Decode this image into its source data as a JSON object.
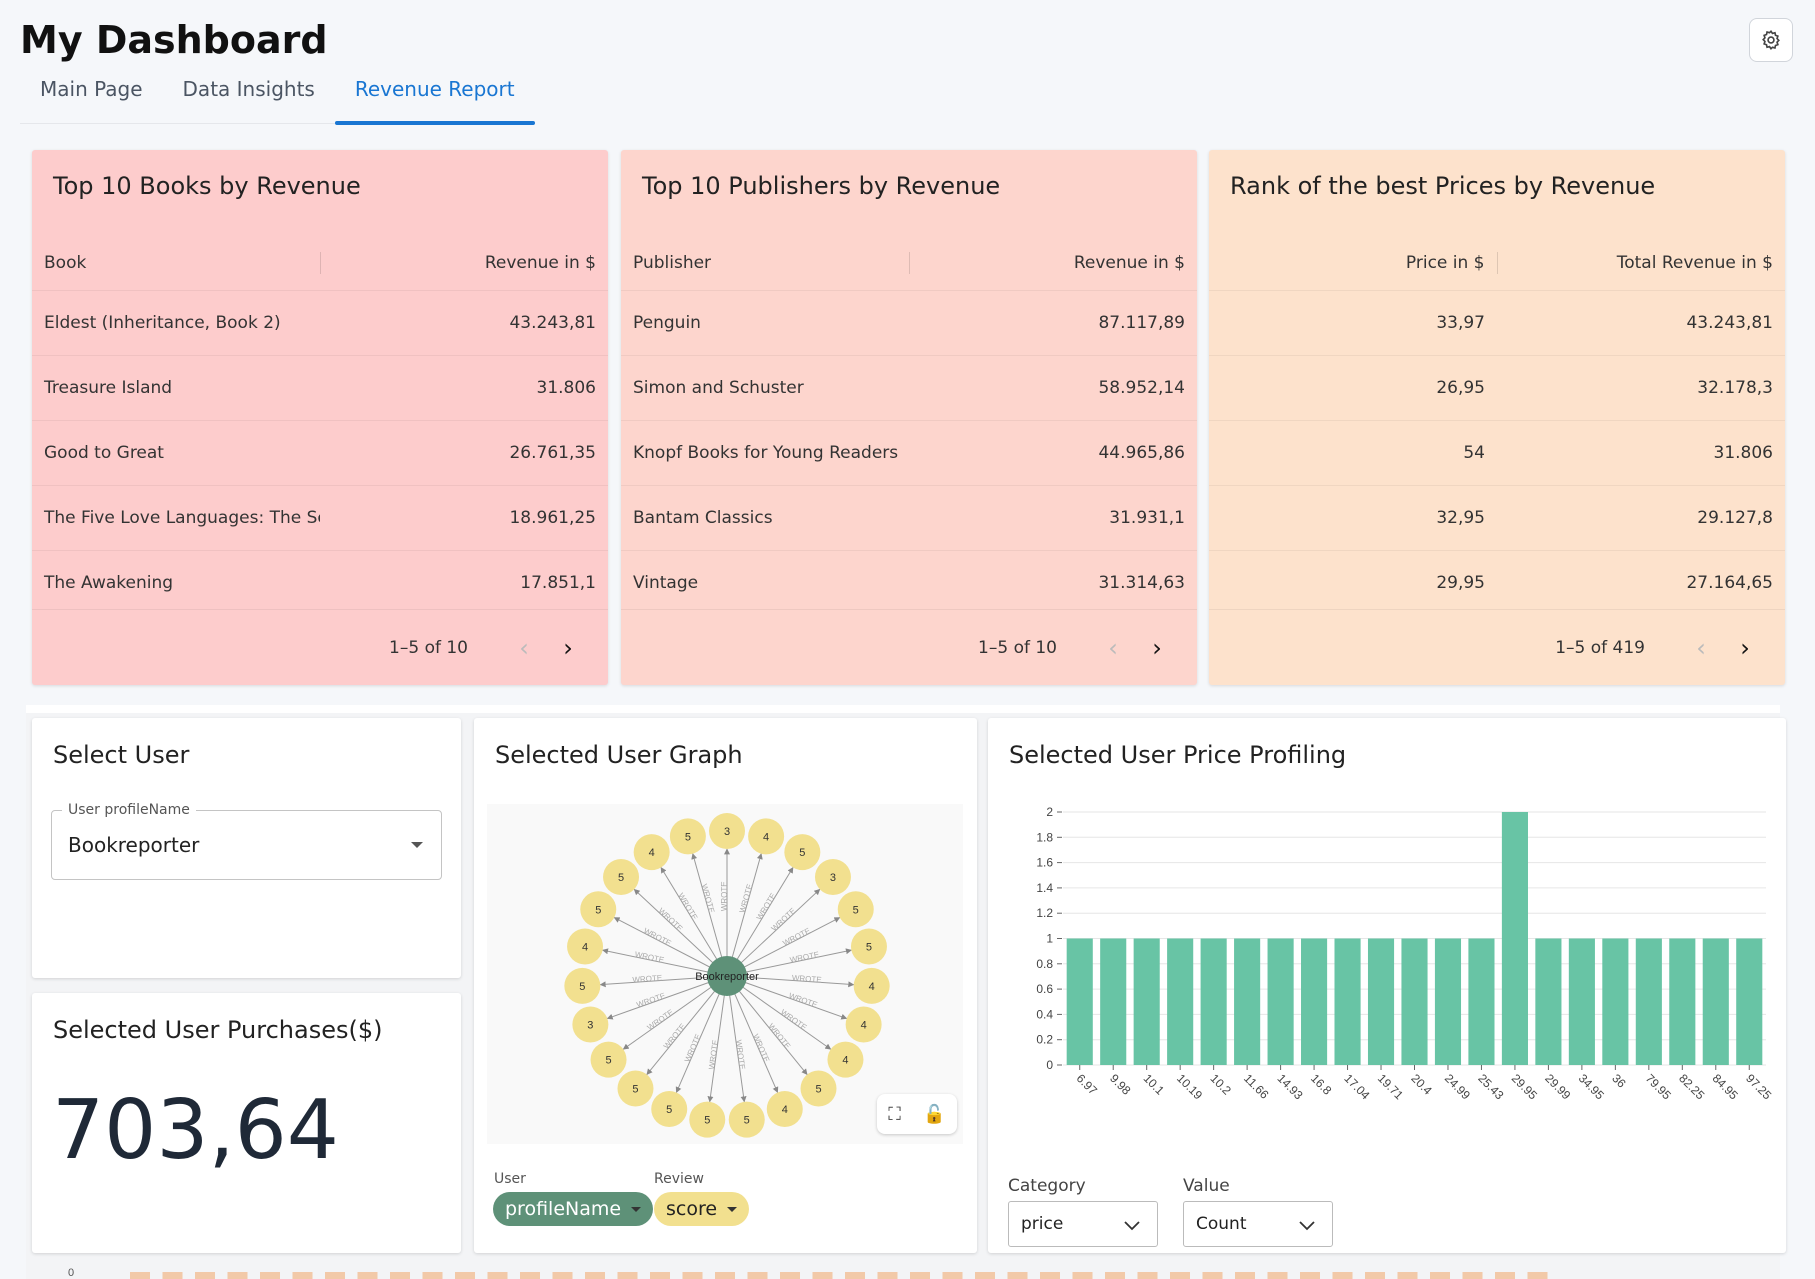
{
  "app": {
    "title": "My Dashboard",
    "tabs": [
      {
        "label": "Main Page",
        "active": false
      },
      {
        "label": "Data Insights",
        "active": false
      },
      {
        "label": "Revenue Report",
        "active": true
      }
    ],
    "accent": "#1976d2"
  },
  "tables": [
    {
      "title": "Top 10 Books by Revenue",
      "bg": "#fdcccc",
      "headers": [
        "Book",
        "Revenue in $"
      ],
      "rows": [
        [
          "Eldest (Inheritance, Book 2)",
          "43.243,81"
        ],
        [
          "Treasure Island",
          "31.806"
        ],
        [
          "Good to Great",
          "26.761,35"
        ],
        [
          "The Five Love Languages: The Secr",
          "18.961,25"
        ],
        [
          "The Awakening",
          "17.851,1"
        ]
      ],
      "pagination": "1–5 of 10"
    },
    {
      "title": "Top 10 Publishers by Revenue",
      "bg": "#fdd5cd",
      "headers": [
        "Publisher",
        "Revenue in $"
      ],
      "rows": [
        [
          "Penguin",
          "87.117,89"
        ],
        [
          "Simon and Schuster",
          "58.952,14"
        ],
        [
          "Knopf Books for Young Readers",
          "44.965,86"
        ],
        [
          "Bantam Classics",
          "31.931,1"
        ],
        [
          "Vintage",
          "31.314,63"
        ]
      ],
      "pagination": "1–5 of 10"
    },
    {
      "title": "Rank of the best Prices by Revenue",
      "bg": "#fde2cc",
      "headers": [
        "Price in $",
        "Total Revenue in $"
      ],
      "rows": [
        [
          "33,97",
          "43.243,81"
        ],
        [
          "26,95",
          "32.178,3"
        ],
        [
          "54",
          "31.806"
        ],
        [
          "32,95",
          "29.127,8"
        ],
        [
          "29,95",
          "27.164,65"
        ]
      ],
      "pagination": "1–5 of 419"
    }
  ],
  "select_user": {
    "title": "Select User",
    "label": "User profileName",
    "value": "Bookreporter"
  },
  "purchases": {
    "title": "Selected User Purchases($)",
    "value": "703,64"
  },
  "graph": {
    "title": "Selected User Graph",
    "center_label": "Bookreporter",
    "edge_label": "WROTE",
    "node_scores": [
      "3",
      "4",
      "5",
      "3",
      "5",
      "5",
      "4",
      "4",
      "4",
      "5",
      "4",
      "5",
      "5",
      "5",
      "5",
      "5",
      "3",
      "5",
      "4",
      "5",
      "5",
      "4",
      "5"
    ],
    "center_color": "#5e9178",
    "node_color": "#f2e08f",
    "legend": {
      "user_label": "User",
      "user_chip": "profileName",
      "review_label": "Review",
      "review_chip": "score"
    }
  },
  "price_profile": {
    "title": "Selected User Price Profiling",
    "category_label": "Category",
    "category_value": "price",
    "value_label": "Value",
    "value_value": "Count",
    "bar_color": "#68c4a5"
  },
  "chart_data": {
    "type": "bar",
    "categories": [
      "6.97",
      "9.98",
      "10.1",
      "10.19",
      "10.2",
      "11.66",
      "14.93",
      "16.8",
      "17.04",
      "19.71",
      "20.4",
      "24.99",
      "25.43",
      "29.95",
      "29.99",
      "34.95",
      "36",
      "79.95",
      "82.25",
      "84.95",
      "97.25"
    ],
    "values": [
      1,
      1,
      1,
      1,
      1,
      1,
      1,
      1,
      1,
      1,
      1,
      1,
      1,
      2,
      1,
      1,
      1,
      1,
      1,
      1,
      1
    ],
    "ylim": [
      0,
      2
    ],
    "yticks": [
      "0",
      "0.2",
      "0.4",
      "0.6",
      "0.8",
      "1",
      "1.2",
      "1.4",
      "1.6",
      "1.8",
      "2"
    ],
    "grid": true
  }
}
